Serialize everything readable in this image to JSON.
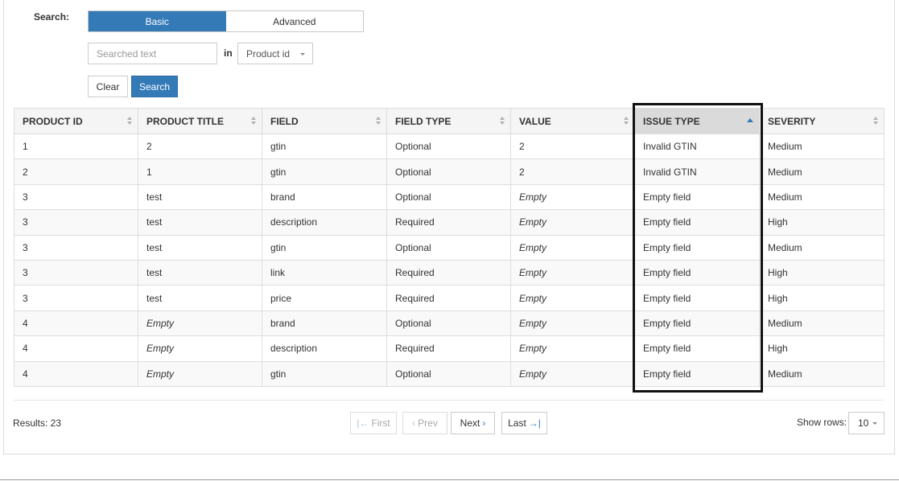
{
  "search": {
    "label": "Search:",
    "modes": [
      "Basic",
      "Advanced"
    ],
    "active_mode": "Basic",
    "placeholder": "Searched text",
    "in_label": "in",
    "field_select": "Product id",
    "clear_label": "Clear",
    "search_label": "Search"
  },
  "table": {
    "columns": [
      "PRODUCT ID",
      "PRODUCT TITLE",
      "FIELD",
      "FIELD TYPE",
      "VALUE",
      "ISSUE TYPE",
      "SEVERITY"
    ],
    "sorted_column": "ISSUE TYPE",
    "sort_direction": "ascending",
    "rows": [
      [
        "1",
        "2",
        "gtin",
        "Optional",
        "2",
        "Invalid GTIN",
        "Medium"
      ],
      [
        "2",
        "1",
        "gtin",
        "Optional",
        "2",
        "Invalid GTIN",
        "Medium"
      ],
      [
        "3",
        "test",
        "brand",
        "Optional",
        "Empty",
        "Empty field",
        "Medium"
      ],
      [
        "3",
        "test",
        "description",
        "Required",
        "Empty",
        "Empty field",
        "High"
      ],
      [
        "3",
        "test",
        "gtin",
        "Optional",
        "Empty",
        "Empty field",
        "Medium"
      ],
      [
        "3",
        "test",
        "link",
        "Required",
        "Empty",
        "Empty field",
        "High"
      ],
      [
        "3",
        "test",
        "price",
        "Required",
        "Empty",
        "Empty field",
        "High"
      ],
      [
        "4",
        "Empty",
        "brand",
        "Optional",
        "Empty",
        "Empty field",
        "Medium"
      ],
      [
        "4",
        "Empty",
        "description",
        "Required",
        "Empty",
        "Empty field",
        "High"
      ],
      [
        "4",
        "Empty",
        "gtin",
        "Optional",
        "Empty",
        "Empty field",
        "Medium"
      ]
    ]
  },
  "footer": {
    "results": "Results: 23",
    "first": "First",
    "prev": "Prev",
    "next": "Next",
    "last": "Last",
    "show_rows_label": "Show rows:",
    "rows_value": "10"
  },
  "colors": {
    "accent": "#337ab7",
    "highlight_border": "#111111"
  }
}
